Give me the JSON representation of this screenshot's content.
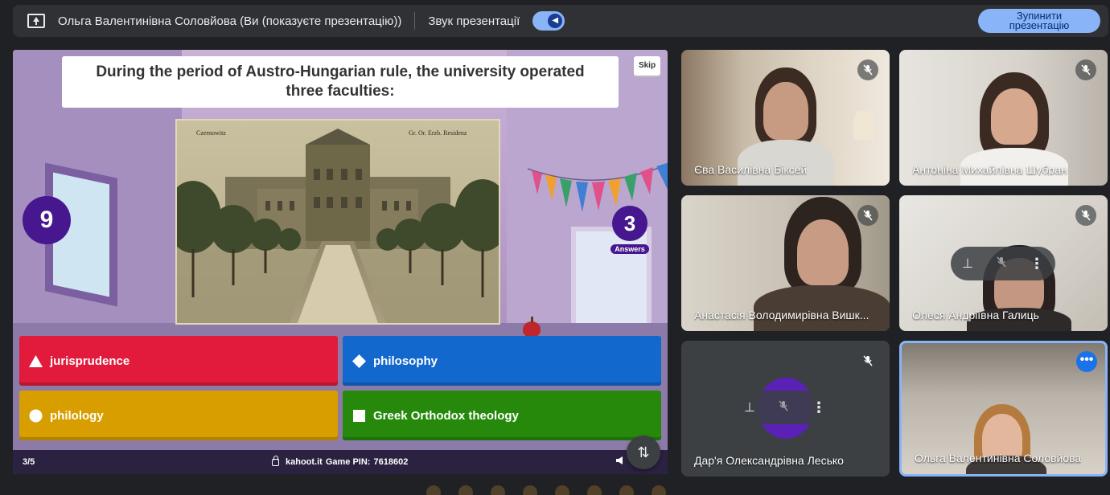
{
  "topbar": {
    "presenter": "Ольга Валентинівна Соловйова (Ви (показуєте презентацію))",
    "sound_label": "Звук презентації",
    "stop_button": "Зупинити презентацію"
  },
  "kahoot": {
    "question": "During the period of Austro-Hungarian rule, the university operated three faculties:",
    "skip_label": "Skip",
    "timer": "9",
    "answers_count": "3",
    "answers_label": "Answers",
    "photo_caption_left": "Czernowitz",
    "photo_caption_right": "Gr. Or. Erzb. Residenz",
    "answers": [
      {
        "text": "jurisprudence",
        "shape": "triangle",
        "color": "#e21b3c"
      },
      {
        "text": "philosophy",
        "shape": "diamond",
        "color": "#1368ce"
      },
      {
        "text": "philology",
        "shape": "circle",
        "color": "#d89e00"
      },
      {
        "text": "Greek Orthodox theology",
        "shape": "square",
        "color": "#26890c"
      }
    ],
    "progress": "3/5",
    "site": "kahoot.it",
    "pin_label": "Game PIN:",
    "pin": "7618602"
  },
  "participants": [
    {
      "name": "Єва Василівна Біксей",
      "muted": true
    },
    {
      "name": "Антоніна Михайлівна Шубран",
      "muted": true
    },
    {
      "name": "Анастасія Володимирівна Вишк...",
      "muted": true
    },
    {
      "name": "Олеся Андріївна Галиць",
      "muted": true
    },
    {
      "name": "Дар'я Олександрівна Лесько",
      "muted": true
    },
    {
      "name": "Ольга Валентинівна Соловйова",
      "muted": false
    }
  ],
  "colors": {
    "accent": "#8ab4f8",
    "kahoot_purple": "#46178f",
    "background": "#202124"
  }
}
